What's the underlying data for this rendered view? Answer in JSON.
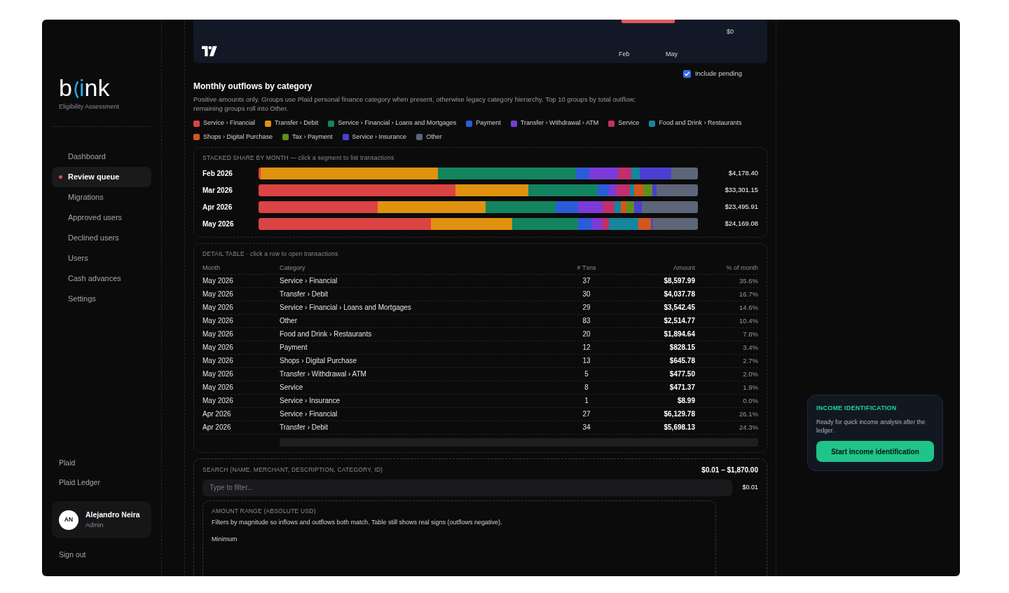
{
  "sidebar": {
    "logo": {
      "lead": "b",
      "accent": "i",
      "tail": "nk"
    },
    "subtitle": "Eligibility Assessment",
    "nav": [
      {
        "label": "Dashboard",
        "selected": false
      },
      {
        "label": "Review queue",
        "selected": true
      },
      {
        "label": "Migrations",
        "selected": false
      },
      {
        "label": "Approved users",
        "selected": false
      },
      {
        "label": "Declined users",
        "selected": false
      },
      {
        "label": "Users",
        "selected": false
      },
      {
        "label": "Cash advances",
        "selected": false
      },
      {
        "label": "Settings",
        "selected": false
      }
    ],
    "footer_links": [
      "Plaid",
      "Plaid Ledger"
    ],
    "user": {
      "initials": "AN",
      "name": "Alejandro Neira",
      "role": "Admin"
    },
    "sign_out": "Sign out"
  },
  "top_chart": {
    "x_labels": [
      "Feb",
      "May"
    ],
    "y_tick": "$0"
  },
  "include_pending": {
    "label": "Include pending",
    "checked": true
  },
  "outflows": {
    "title": "Monthly outflows by category",
    "description": "Positive amounts only. Groups use Plaid personal finance category when present, otherwise legacy category hierarchy. Top 10 groups by total outflow; remaining groups roll into Other.",
    "legend": [
      {
        "label": "Service › Financial",
        "color": "#dc4343"
      },
      {
        "label": "Transfer › Debit",
        "color": "#e0920f"
      },
      {
        "label": "Service › Financial › Loans and Mortgages",
        "color": "#138460"
      },
      {
        "label": "Payment",
        "color": "#2a5cd8"
      },
      {
        "label": "Transfer › Withdrawal › ATM",
        "color": "#7b3bd9"
      },
      {
        "label": "Service",
        "color": "#c1306b"
      },
      {
        "label": "Food and Drink › Restaurants",
        "color": "#15869b"
      },
      {
        "label": "Shops › Digital Purchase",
        "color": "#d4561b"
      },
      {
        "label": "Tax › Payment",
        "color": "#5f8e1d"
      },
      {
        "label": "Service › Insurance",
        "color": "#4a3fd1"
      },
      {
        "label": "Other",
        "color": "#5c6678"
      }
    ],
    "chart_title": "STACKED SHARE BY MONTH — click a segment to list transactions",
    "months": [
      {
        "label": "Feb 2026",
        "total": "$4,178.40"
      },
      {
        "label": "Mar 2026",
        "total": "$33,301.15"
      },
      {
        "label": "Apr 2026",
        "total": "$23,495.91"
      },
      {
        "label": "May 2026",
        "total": "$24,169.08"
      }
    ]
  },
  "detail_table": {
    "title": "DETAIL TABLE · click a row to open transactions",
    "columns": [
      "Month",
      "Category",
      "# Txns",
      "Amount",
      "% of month"
    ],
    "rows": [
      {
        "month": "May 2026",
        "category": "Service › Financial",
        "txns": "37",
        "amount": "$8,597.99",
        "share": "35.6%"
      },
      {
        "month": "May 2026",
        "category": "Transfer › Debit",
        "txns": "30",
        "amount": "$4,037.78",
        "share": "16.7%"
      },
      {
        "month": "May 2026",
        "category": "Service › Financial › Loans and Mortgages",
        "txns": "29",
        "amount": "$3,542.45",
        "share": "14.6%"
      },
      {
        "month": "May 2026",
        "category": "Other",
        "txns": "83",
        "amount": "$2,514.77",
        "share": "10.4%"
      },
      {
        "month": "May 2026",
        "category": "Food and Drink › Restaurants",
        "txns": "20",
        "amount": "$1,894.64",
        "share": "7.8%"
      },
      {
        "month": "May 2026",
        "category": "Payment",
        "txns": "12",
        "amount": "$828.15",
        "share": "3.4%"
      },
      {
        "month": "May 2026",
        "category": "Shops › Digital Purchase",
        "txns": "13",
        "amount": "$645.78",
        "share": "2.7%"
      },
      {
        "month": "May 2026",
        "category": "Transfer › Withdrawal › ATM",
        "txns": "5",
        "amount": "$477.50",
        "share": "2.0%"
      },
      {
        "month": "May 2026",
        "category": "Service",
        "txns": "8",
        "amount": "$471.37",
        "share": "1.9%"
      },
      {
        "month": "May 2026",
        "category": "Service › Insurance",
        "txns": "1",
        "amount": "$8.99",
        "share": "0.0%"
      },
      {
        "month": "Apr 2026",
        "category": "Service › Financial",
        "txns": "27",
        "amount": "$6,129.78",
        "share": "26.1%"
      },
      {
        "month": "Apr 2026",
        "category": "Transfer › Debit",
        "txns": "34",
        "amount": "$5,698.13",
        "share": "24.3%"
      }
    ]
  },
  "filters": {
    "search_label": "SEARCH (NAME, MERCHANT, DESCRIPTION, CATEGORY, ID)",
    "search": {
      "placeholder": "Type to filter..."
    },
    "range_value": "$0.01 – $1,870.00",
    "range_min": "$0.01",
    "amount_title": "AMOUNT RANGE (ABSOLUTE USD)",
    "amount_note": "Filters by magnitude so inflows and outflows both match. Table still shows real signs (outflows negative).",
    "minimum_label": "Minimum"
  },
  "income_card": {
    "title": "INCOME IDENTIFICATION",
    "text": "Ready for quick income analysis after the ledger.",
    "button": "Start income identification"
  }
}
